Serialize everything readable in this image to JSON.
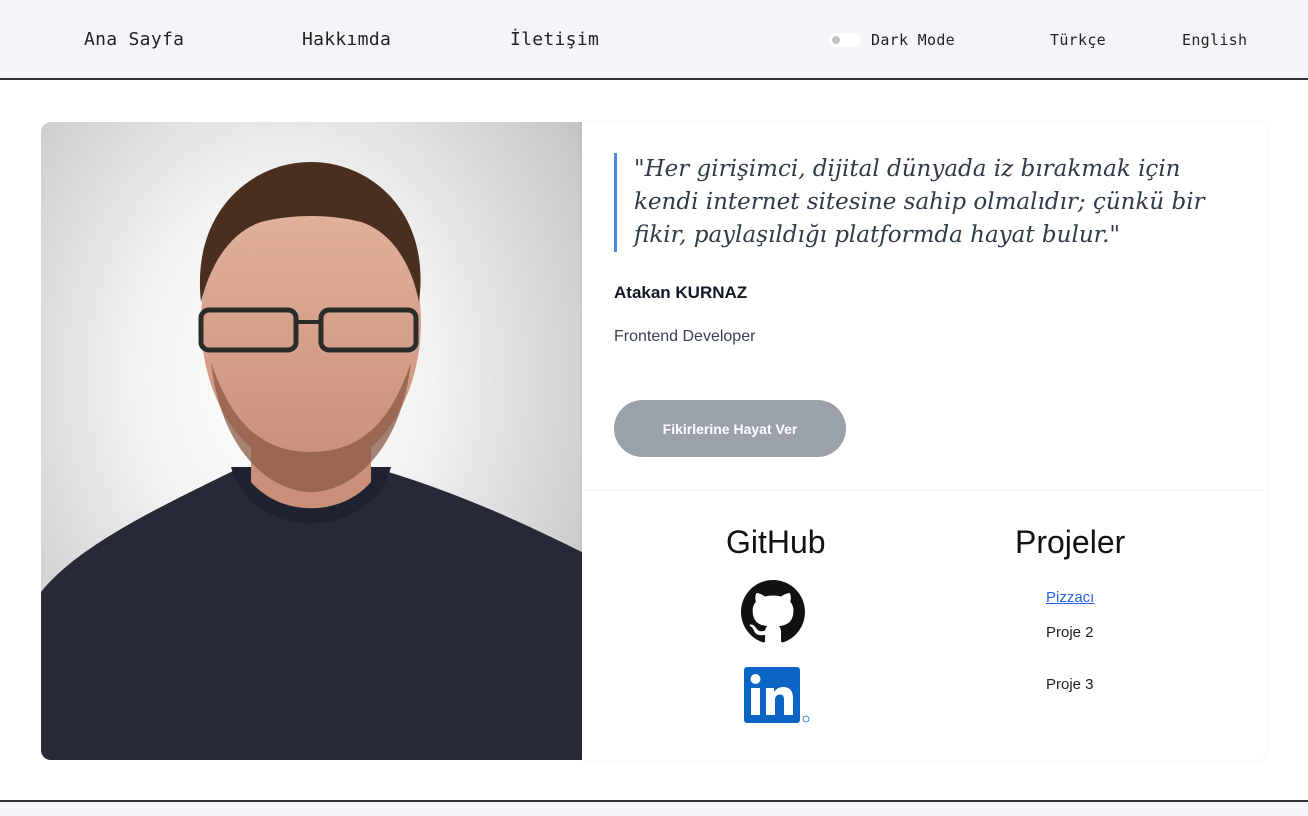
{
  "nav": {
    "home": "Ana Sayfa",
    "about": "Hakkımda",
    "contact": "İletişim",
    "dark_mode": "Dark Mode",
    "lang_tr": "Türkçe",
    "lang_en": "English",
    "dark_mode_enabled": false
  },
  "hero": {
    "quote": "\"Her girişimci, dijital dünyada iz bırakmak için kendi internet sitesine sahip olmalıdır; çünkü bir fikir, paylaşıldığı platformda hayat bulur.\"",
    "author": "Atakan KURNAZ",
    "role": "Frontend Developer",
    "cta": "Fikirlerine Hayat Ver",
    "accent": "#4a86e8",
    "button_color": "#9ba1ab"
  },
  "social": {
    "title": "GitHub",
    "icons": [
      "github-icon",
      "linkedin-icon"
    ]
  },
  "projects": {
    "title": "Projeler",
    "items": [
      "Pizzacı",
      "Proje 2",
      "Proje 3"
    ]
  },
  "colors": {
    "link": "#2563eb",
    "linkedin": "#0a66c2"
  }
}
